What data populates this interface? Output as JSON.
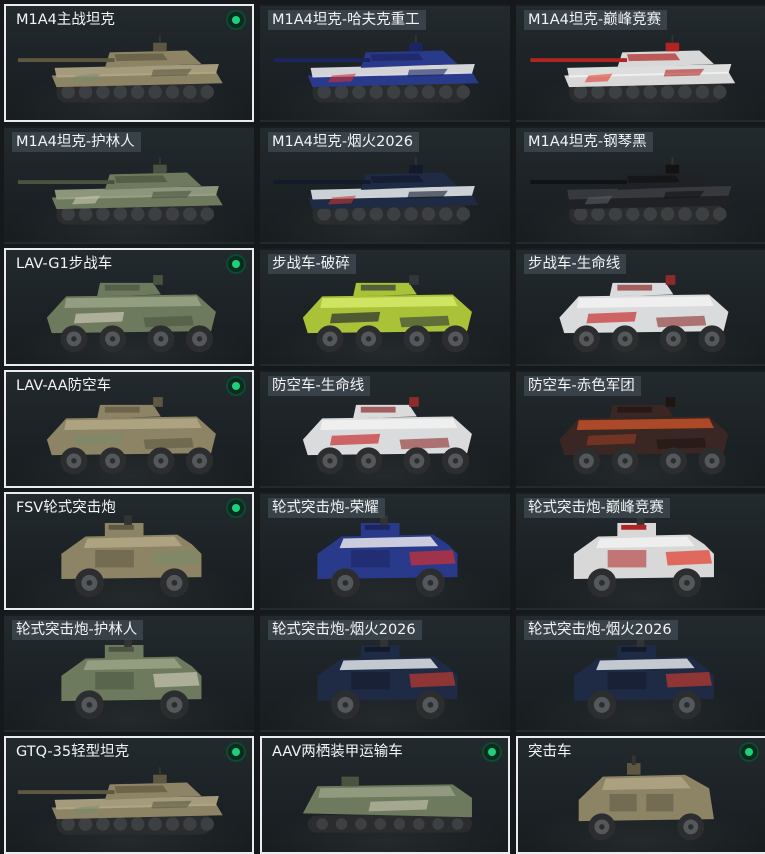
{
  "colors": {
    "selected_border": "#e9ecee",
    "owned_indicator": "#1fd07a",
    "card_bg": "#1e2427"
  },
  "vehicles": [
    {
      "name": "M1A4主战坦克",
      "kind": "tank",
      "paint": "camo-tan",
      "selected": true,
      "owned": true,
      "tag": false
    },
    {
      "name": "M1A4坦克-哈夫克重工",
      "kind": "tank",
      "paint": "blue-white",
      "selected": false,
      "owned": false,
      "tag": true
    },
    {
      "name": "M1A4坦克-巅峰竞赛",
      "kind": "tank",
      "paint": "red-white",
      "selected": false,
      "owned": false,
      "tag": true
    },
    {
      "name": "M1A4坦克-护林人",
      "kind": "tank",
      "paint": "camo-green",
      "selected": false,
      "owned": false,
      "tag": true
    },
    {
      "name": "M1A4坦克-烟火2026",
      "kind": "tank",
      "paint": "dark-blue",
      "selected": false,
      "owned": false,
      "tag": true
    },
    {
      "name": "M1A4坦克-钢琴黑",
      "kind": "tank",
      "paint": "black",
      "selected": false,
      "owned": false,
      "tag": true
    },
    {
      "name": "LAV-G1步战车",
      "kind": "ifv",
      "paint": "camo-green",
      "selected": true,
      "owned": true,
      "tag": false
    },
    {
      "name": "步战车-破碎",
      "kind": "ifv",
      "paint": "lime",
      "selected": false,
      "owned": false,
      "tag": true
    },
    {
      "name": "步战车-生命线",
      "kind": "ifv",
      "paint": "white-red",
      "selected": false,
      "owned": false,
      "tag": true
    },
    {
      "name": "LAV-AA防空车",
      "kind": "ifv",
      "paint": "camo-tan",
      "selected": true,
      "owned": true,
      "tag": false
    },
    {
      "name": "防空车-生命线",
      "kind": "ifv",
      "paint": "white-red",
      "selected": false,
      "owned": false,
      "tag": true
    },
    {
      "name": "防空车-赤色军团",
      "kind": "ifv",
      "paint": "rust",
      "selected": false,
      "owned": false,
      "tag": true
    },
    {
      "name": "FSV轮式突击炮",
      "kind": "mrap",
      "paint": "camo-tan",
      "selected": true,
      "owned": true,
      "tag": false
    },
    {
      "name": "轮式突击炮-荣耀",
      "kind": "mrap",
      "paint": "blue-white",
      "selected": false,
      "owned": false,
      "tag": true
    },
    {
      "name": "轮式突击炮-巅峰竞赛",
      "kind": "mrap",
      "paint": "red-white",
      "selected": false,
      "owned": false,
      "tag": true
    },
    {
      "name": "轮式突击炮-护林人",
      "kind": "mrap",
      "paint": "camo-green",
      "selected": false,
      "owned": false,
      "tag": true
    },
    {
      "name": "轮式突击炮-烟火2026",
      "kind": "mrap",
      "paint": "dark-blue",
      "selected": false,
      "owned": false,
      "tag": true
    },
    {
      "name": "轮式突击炮-烟火2026",
      "kind": "mrap",
      "paint": "dark-blue",
      "selected": false,
      "owned": false,
      "tag": true
    },
    {
      "name": "GTQ-35轻型坦克",
      "kind": "tank",
      "paint": "camo-tan",
      "selected": true,
      "owned": true,
      "tag": false
    },
    {
      "name": "AAV两栖装甲运输车",
      "kind": "aav",
      "paint": "camo-green",
      "selected": true,
      "owned": true,
      "tag": false
    },
    {
      "name": "突击车",
      "kind": "truck",
      "paint": "camo-tan",
      "selected": true,
      "owned": true,
      "tag": false
    }
  ]
}
